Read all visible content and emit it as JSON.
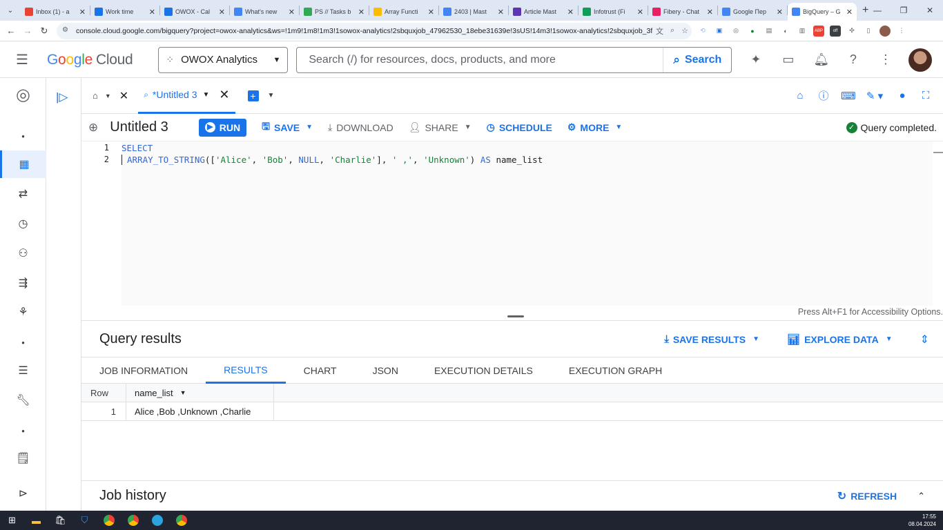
{
  "browser": {
    "tabs": [
      {
        "title": "Inbox (1) - a",
        "color": "#ea4335"
      },
      {
        "title": "Work time",
        "color": "#1a73e8"
      },
      {
        "title": "OWOX - Cal",
        "color": "#1a73e8"
      },
      {
        "title": "What's new",
        "color": "#4285f4"
      },
      {
        "title": "PS // Tasks b",
        "color": "#34a853"
      },
      {
        "title": "Array Functi",
        "color": "#fbbc05"
      },
      {
        "title": "2403 | Mast",
        "color": "#4285f4"
      },
      {
        "title": "Article Mast",
        "color": "#5e35b1"
      },
      {
        "title": "Infotrust (Fi",
        "color": "#0f9d58"
      },
      {
        "title": "Fibery - Chat",
        "color": "#e91e63"
      },
      {
        "title": "Google Пер",
        "color": "#4285f4"
      },
      {
        "title": "BigQuery – G",
        "color": "#4285f4"
      }
    ],
    "url": "console.cloud.google.com/bigquery?project=owox-analytics&ws=!1m9!1m8!1m3!1sowox-analytics!2sbquxjob_47962530_18ebe31639e!3sUS!14m3!1sowox-analytics!2sbquxjob_3fce36f3_..."
  },
  "header": {
    "logo_google": [
      "G",
      "o",
      "o",
      "g",
      "l",
      "e"
    ],
    "logo_cloud": "Cloud",
    "project": "OWOX Analytics",
    "search_placeholder": "Search (/) for resources, docs, products, and more",
    "search_button": "Search"
  },
  "query_tab": {
    "title": "*Untitled 3"
  },
  "toolbar": {
    "title": "Untitled 3",
    "run": "RUN",
    "save": "SAVE",
    "download": "DOWNLOAD",
    "share": "SHARE",
    "schedule": "SCHEDULE",
    "more": "MORE",
    "status": "Query completed."
  },
  "editor": {
    "line_numbers": [
      "1",
      "2"
    ],
    "line1_kw": "SELECT",
    "line2": {
      "fn": "ARRAY_TO_STRING",
      "open": "([",
      "s1": "'Alice'",
      "sep1": ", ",
      "s2": "'Bob'",
      "sep2": ", ",
      "null": "NULL",
      "sep3": ", ",
      "s3": "'Charlie'",
      "close": "], ",
      "s4": "' ,'",
      "sep4": ", ",
      "s5": "'Unknown'",
      "close2": ") ",
      "as": "AS",
      "alias": " name_list"
    },
    "accessibility_hint": "Press Alt+F1 for Accessibility Options."
  },
  "results": {
    "title": "Query results",
    "save_results": "SAVE RESULTS",
    "explore_data": "EXPLORE DATA",
    "tabs": [
      "JOB INFORMATION",
      "RESULTS",
      "CHART",
      "JSON",
      "EXECUTION DETAILS",
      "EXECUTION GRAPH"
    ],
    "active_tab": "RESULTS",
    "columns": [
      "Row",
      "name_list"
    ],
    "rows": [
      {
        "row": "1",
        "name_list": "Alice ,Bob ,Unknown ,Charlie"
      }
    ]
  },
  "job_history": {
    "title": "Job history",
    "refresh": "REFRESH"
  },
  "taskbar": {
    "time": "17:55",
    "date": "08.04.2024"
  },
  "colors": {
    "accent": "#1a73e8",
    "success": "#188038"
  }
}
